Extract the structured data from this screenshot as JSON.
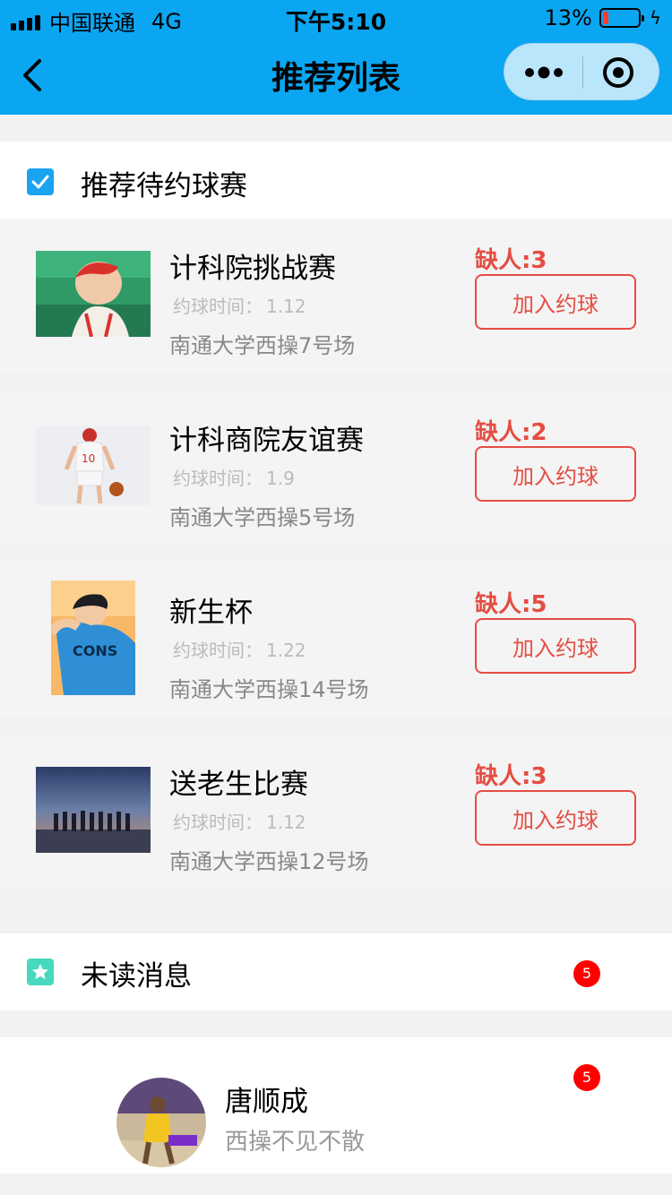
{
  "status_bar": {
    "carrier": "中国联通",
    "network": "4G",
    "time": "下午5:10",
    "battery": "13%"
  },
  "nav": {
    "title": "推荐列表",
    "icons": [
      "back-icon",
      "more-dots-icon",
      "target-icon"
    ]
  },
  "recommend_section": {
    "title": "推荐待约球赛",
    "icon": "checkbox-icon"
  },
  "matches": [
    {
      "title": "计科院挑战赛",
      "time_label": "约球时间：",
      "time_value": "1.12",
      "place": "南通大学西操7号场",
      "missing": "缺人:3",
      "join_label": "加入约球"
    },
    {
      "title": "计科商院友谊赛",
      "time_label": "约球时间：",
      "time_value": "1.9",
      "place": "南通大学西操5号场",
      "missing": "缺人:2",
      "join_label": "加入约球"
    },
    {
      "title": "新生杯",
      "time_label": "约球时间：",
      "time_value": "1.22",
      "place": "南通大学西操14号场",
      "missing": "缺人:5",
      "join_label": "加入约球"
    },
    {
      "title": "送老生比赛",
      "time_label": "约球时间：",
      "time_value": "1.12",
      "place": "南通大学西操12号场",
      "missing": "缺人:3",
      "join_label": "加入约球"
    }
  ],
  "unread_section": {
    "title": "未读消息",
    "badge": "5",
    "icon": "star-icon"
  },
  "messages": [
    {
      "name": "唐顺成",
      "preview": "西操不见不散",
      "badge": "5"
    }
  ],
  "colors": {
    "nav_bg": "#0aa6f2",
    "accent_red": "#e54d42",
    "check_blue": "#1aa3f0",
    "star_green": "#47d9bf"
  }
}
